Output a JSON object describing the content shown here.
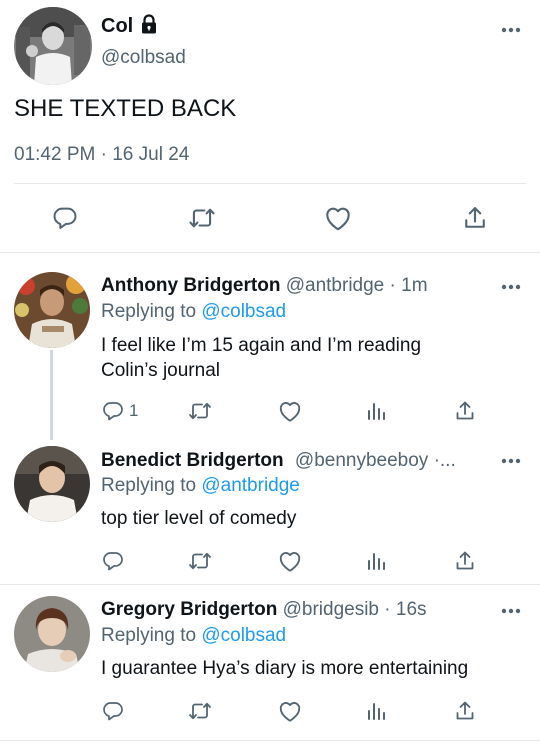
{
  "main_tweet": {
    "name": "Col",
    "handle": "@colbsad",
    "text": "SHE TEXTED BACK",
    "time": "01:42 PM",
    "dot": "·",
    "date": "16 Jul 24"
  },
  "replies": [
    {
      "name": "Anthony Bridgerton",
      "handle": "@antbridge",
      "time": "· 1m",
      "replying_prefix": "Replying to",
      "replying_to": "@colbsad",
      "text_line1": "I feel like I’m 15 again and I’m reading",
      "text_line2": "Colin’s journal",
      "reply_count": "1"
    },
    {
      "name": "Benedict Bridgerton",
      "handle": "@bennybeeboy ·...",
      "replying_prefix": "Replying to",
      "replying_to": "@antbridge",
      "text": "top tier level of comedy"
    },
    {
      "name": "Gregory Bridgerton",
      "handle": "@bridgesib",
      "time": "· 16s",
      "replying_prefix": "Replying to",
      "replying_to": "@colbsad",
      "text": "I guarantee Hya’s diary is more entertaining"
    }
  ],
  "colors": {
    "accent": "#1d9bf0",
    "secondary": "#536471",
    "divider": "#e6e6e6"
  },
  "icons": [
    "lock-icon",
    "more-icon",
    "reply-icon",
    "retweet-icon",
    "like-icon",
    "analytics-icon",
    "share-icon"
  ]
}
